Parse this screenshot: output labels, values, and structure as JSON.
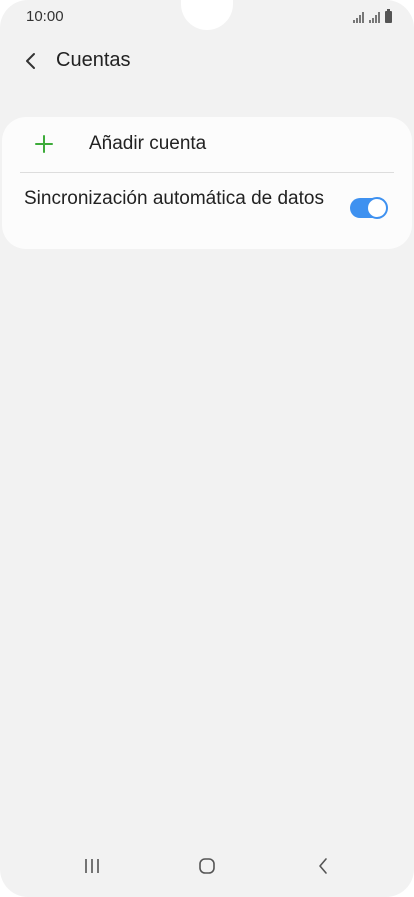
{
  "status_bar": {
    "time": "10:00"
  },
  "header": {
    "title": "Cuentas",
    "back_icon": "chevron-left-icon"
  },
  "accounts": {
    "add_account_label": "Añadir cuenta",
    "add_icon": "plus-icon",
    "sync_label": "Sincronización automática de datos",
    "sync_enabled": true
  },
  "colors": {
    "accent_green": "#3dab3a",
    "toggle_blue": "#3e91f0",
    "background": "#f2f2f2",
    "card": "#fcfcfc"
  },
  "nav_bar": {
    "items": [
      "recent-apps-icon",
      "home-icon",
      "back-icon"
    ]
  }
}
